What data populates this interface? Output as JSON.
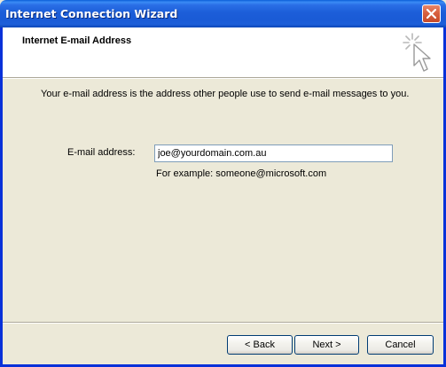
{
  "window": {
    "title": "Internet Connection Wizard",
    "close_icon": "close-x-icon"
  },
  "header": {
    "title": "Internet E-mail Address",
    "icon": "wizard-cursor-icon"
  },
  "content": {
    "intro": "Your e-mail address is the address other people use to send e-mail messages to you.",
    "email_label": "E-mail address:",
    "email_value": "joe@yourdomain.com.au",
    "example": "For example: someone@microsoft.com"
  },
  "buttons": {
    "back": "< Back",
    "next": "Next >",
    "cancel": "Cancel"
  },
  "colors": {
    "titlebar": "#1c5ed9",
    "dialog_bg": "#ece9d8",
    "close_button": "#d8603f"
  }
}
